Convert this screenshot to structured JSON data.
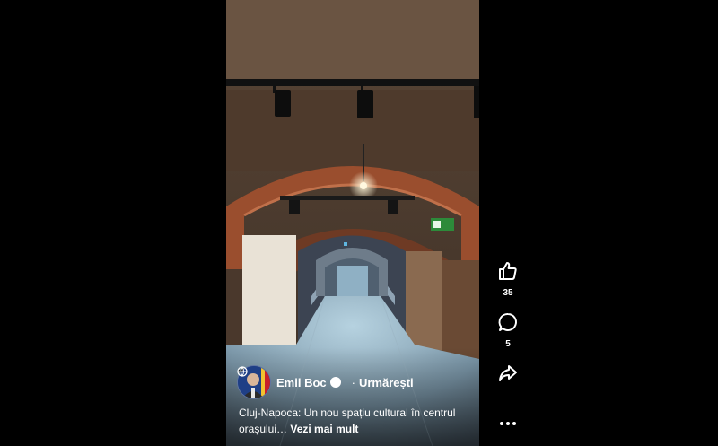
{
  "post": {
    "author": "Emil Boc",
    "follow_separator": "·",
    "follow_label": "Urmărești",
    "caption": "Cluj-Napoca: Un nou spațiu cultural în centrul orașului…",
    "see_more": "Vezi mai mult"
  },
  "actions": {
    "like_count": "35",
    "comment_count": "5"
  },
  "icons": {
    "like": "thumbs-up-icon",
    "comment": "comment-icon",
    "share": "share-icon",
    "more": "more-options-icon",
    "verified": "verified-badge-icon",
    "audience": "globe-icon"
  }
}
